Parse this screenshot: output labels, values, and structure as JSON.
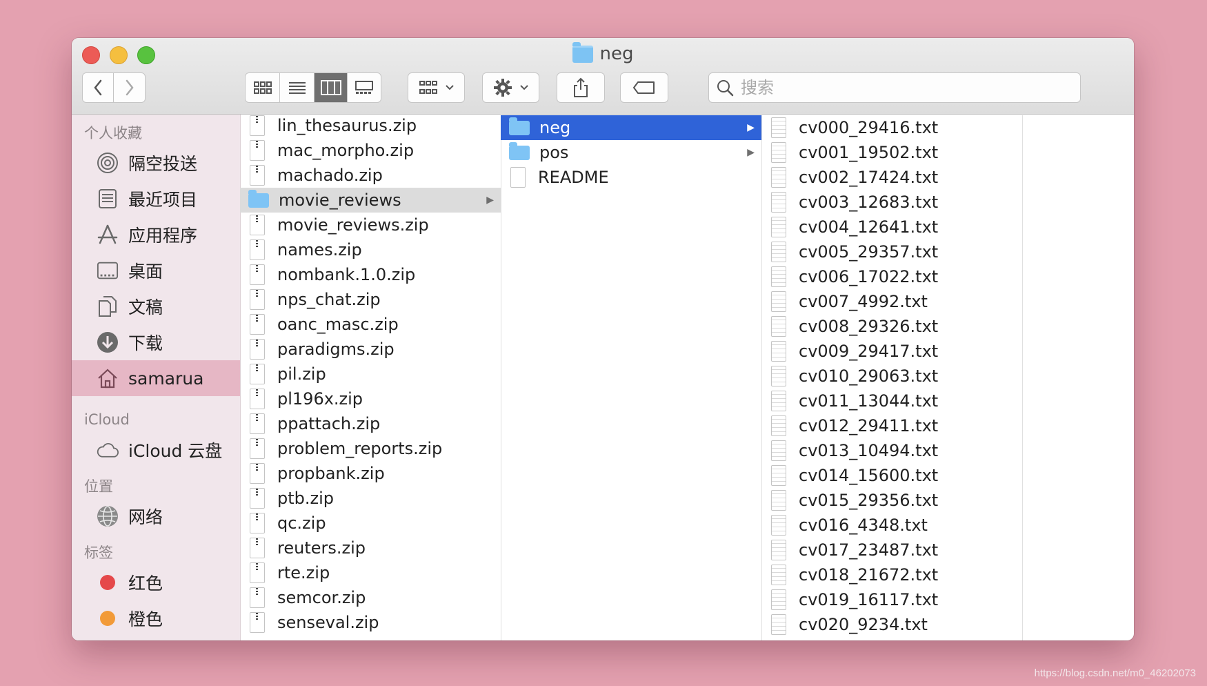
{
  "window": {
    "title": "neg"
  },
  "search": {
    "placeholder": "搜索"
  },
  "sidebar": {
    "sections": [
      {
        "title": "个人收藏",
        "items": [
          {
            "label": "隔空投送",
            "icon": "airdrop-icon"
          },
          {
            "label": "最近项目",
            "icon": "recents-icon"
          },
          {
            "label": "应用程序",
            "icon": "applications-icon"
          },
          {
            "label": "桌面",
            "icon": "desktop-icon"
          },
          {
            "label": "文稿",
            "icon": "documents-icon"
          },
          {
            "label": "下载",
            "icon": "downloads-icon"
          },
          {
            "label": "samarua",
            "icon": "home-icon",
            "active": true
          }
        ]
      },
      {
        "title": "iCloud",
        "items": [
          {
            "label": "iCloud 云盘",
            "icon": "cloud-icon"
          }
        ]
      },
      {
        "title": "位置",
        "items": [
          {
            "label": "网络",
            "icon": "network-icon"
          }
        ]
      },
      {
        "title": "标签",
        "items": [
          {
            "label": "红色",
            "icon": "tag-red-icon",
            "color": "#e5484a"
          },
          {
            "label": "橙色",
            "icon": "tag-orange-icon",
            "color": "#f29a38"
          }
        ]
      }
    ]
  },
  "col1": {
    "items": [
      {
        "label": "lin_thesaurus.zip",
        "type": "zip"
      },
      {
        "label": "mac_morpho.zip",
        "type": "zip"
      },
      {
        "label": "machado.zip",
        "type": "zip"
      },
      {
        "label": "movie_reviews",
        "type": "folder",
        "selected": true
      },
      {
        "label": "movie_reviews.zip",
        "type": "zip"
      },
      {
        "label": "names.zip",
        "type": "zip"
      },
      {
        "label": "nombank.1.0.zip",
        "type": "zip"
      },
      {
        "label": "nps_chat.zip",
        "type": "zip"
      },
      {
        "label": "oanc_masc.zip",
        "type": "zip"
      },
      {
        "label": "paradigms.zip",
        "type": "zip"
      },
      {
        "label": "pil.zip",
        "type": "zip"
      },
      {
        "label": "pl196x.zip",
        "type": "zip"
      },
      {
        "label": "ppattach.zip",
        "type": "zip"
      },
      {
        "label": "problem_reports.zip",
        "type": "zip"
      },
      {
        "label": "propbank.zip",
        "type": "zip"
      },
      {
        "label": "ptb.zip",
        "type": "zip"
      },
      {
        "label": "qc.zip",
        "type": "zip"
      },
      {
        "label": "reuters.zip",
        "type": "zip"
      },
      {
        "label": "rte.zip",
        "type": "zip"
      },
      {
        "label": "semcor.zip",
        "type": "zip"
      },
      {
        "label": "senseval.zip",
        "type": "zip"
      }
    ]
  },
  "col2": {
    "items": [
      {
        "label": "neg",
        "type": "folder",
        "selected": true
      },
      {
        "label": "pos",
        "type": "folder"
      },
      {
        "label": "README",
        "type": "doc"
      }
    ]
  },
  "col3": {
    "items": [
      "cv000_29416.txt",
      "cv001_19502.txt",
      "cv002_17424.txt",
      "cv003_12683.txt",
      "cv004_12641.txt",
      "cv005_29357.txt",
      "cv006_17022.txt",
      "cv007_4992.txt",
      "cv008_29326.txt",
      "cv009_29417.txt",
      "cv010_29063.txt",
      "cv011_13044.txt",
      "cv012_29411.txt",
      "cv013_10494.txt",
      "cv014_15600.txt",
      "cv015_29356.txt",
      "cv016_4348.txt",
      "cv017_23487.txt",
      "cv018_21672.txt",
      "cv019_16117.txt",
      "cv020_9234.txt"
    ]
  },
  "watermark": "https://blog.csdn.net/m0_46202073"
}
